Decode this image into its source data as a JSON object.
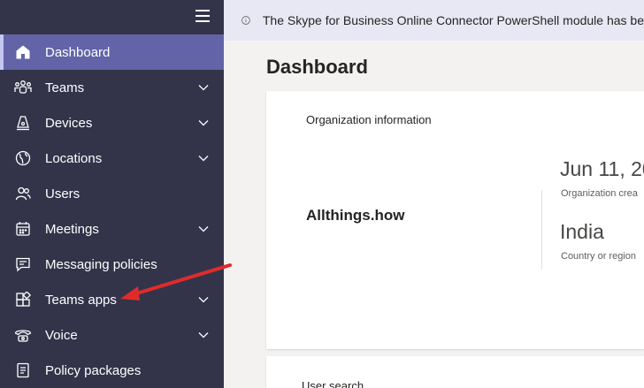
{
  "sidebar": {
    "items": [
      {
        "label": "Dashboard",
        "icon": "home-icon",
        "active": true,
        "chevron": false
      },
      {
        "label": "Teams",
        "icon": "teams-icon",
        "active": false,
        "chevron": true
      },
      {
        "label": "Devices",
        "icon": "devices-icon",
        "active": false,
        "chevron": true
      },
      {
        "label": "Locations",
        "icon": "globe-icon",
        "active": false,
        "chevron": true
      },
      {
        "label": "Users",
        "icon": "users-icon",
        "active": false,
        "chevron": false
      },
      {
        "label": "Meetings",
        "icon": "calendar-icon",
        "active": false,
        "chevron": true
      },
      {
        "label": "Messaging policies",
        "icon": "chat-icon",
        "active": false,
        "chevron": false
      },
      {
        "label": "Teams apps",
        "icon": "apps-icon",
        "active": false,
        "chevron": true
      },
      {
        "label": "Voice",
        "icon": "phone-icon",
        "active": false,
        "chevron": true
      },
      {
        "label": "Policy packages",
        "icon": "package-icon",
        "active": false,
        "chevron": false
      }
    ]
  },
  "banner": {
    "text": "The Skype for Business Online Connector PowerShell module has be"
  },
  "main": {
    "title": "Dashboard",
    "org_card": {
      "title": "Organization information",
      "org_name": "Allthings.how",
      "created_value": "Jun 11, 20",
      "created_label": "Organization crea",
      "country_value": "India",
      "country_label": "Country or region"
    },
    "user_search_card": {
      "title": "User search"
    }
  },
  "colors": {
    "sidebar_bg": "#33344a",
    "active_bg": "#6264a7",
    "banner_bg": "#e8e8f4",
    "arrow": "#e02b2b"
  }
}
